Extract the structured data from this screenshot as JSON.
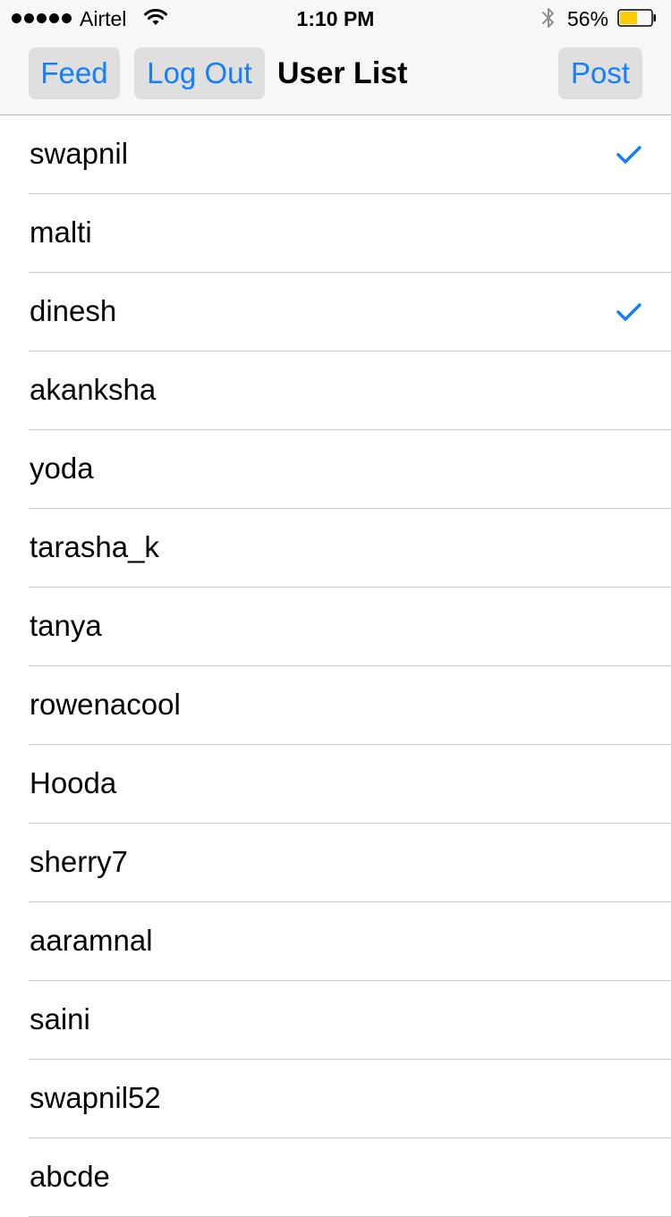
{
  "status_bar": {
    "carrier": "Airtel",
    "time": "1:10 PM",
    "battery_percent": "56%",
    "battery_level": 0.56,
    "signal_bars": 5,
    "battery_color": "#ffcc00"
  },
  "nav": {
    "feed_label": "Feed",
    "logout_label": "Log Out",
    "title": "User List",
    "post_label": "Post",
    "accent_color": "#147efb"
  },
  "users": [
    {
      "name": "swapnil",
      "checked": true
    },
    {
      "name": "malti",
      "checked": false
    },
    {
      "name": "dinesh",
      "checked": true
    },
    {
      "name": "akanksha",
      "checked": false
    },
    {
      "name": "yoda",
      "checked": false
    },
    {
      "name": "tarasha_k",
      "checked": false
    },
    {
      "name": "tanya",
      "checked": false
    },
    {
      "name": "rowenacool",
      "checked": false
    },
    {
      "name": "Hooda",
      "checked": false
    },
    {
      "name": "sherry7",
      "checked": false
    },
    {
      "name": "aaramnal",
      "checked": false
    },
    {
      "name": "saini",
      "checked": false
    },
    {
      "name": "swapnil52",
      "checked": false
    },
    {
      "name": "abcde",
      "checked": false
    }
  ]
}
